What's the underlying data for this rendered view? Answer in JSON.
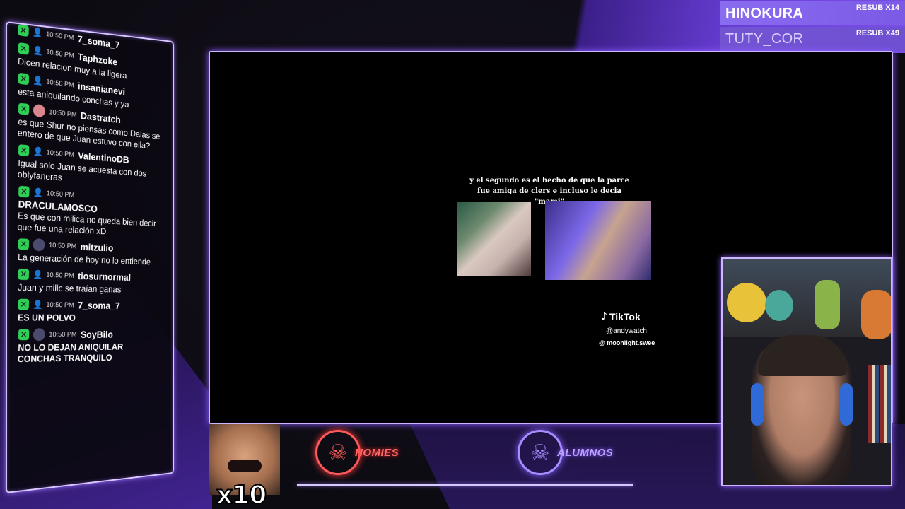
{
  "sub_alerts": [
    {
      "name": "HINOKURA",
      "label": "RESUB X14"
    },
    {
      "name": "TUTY_COR",
      "label": "RESUB X49"
    }
  ],
  "chat": {
    "messages": [
      {
        "time": "10:50 PM",
        "user": "7_soma_7",
        "text": ""
      },
      {
        "time": "10:50 PM",
        "user": "Taphzoke",
        "text": "Dicen relacion muy a la ligera"
      },
      {
        "time": "10:50 PM",
        "user": "insanianevi",
        "text": "esta aniquilando conchas y ya"
      },
      {
        "time": "10:50 PM",
        "user": "Dastratch",
        "text": "es que Shur no piensas como Dalas se entero de que Juan estuvo con ella?"
      },
      {
        "time": "10:50 PM",
        "user": "ValentinoDB",
        "text": "Igual solo Juan se acuesta con dos oblyfaneras"
      },
      {
        "time": "10:50 PM",
        "user": "DRACULAMOSCO",
        "text": "Es que con milica no queda bien decir que fue una relación xD"
      },
      {
        "time": "10:50 PM",
        "user": "mitzulio",
        "text": "La generación de hoy no lo entiende"
      },
      {
        "time": "10:50 PM",
        "user": "tiosurnormal",
        "text": "Juan y milic se traían ganas"
      },
      {
        "time": "10:50 PM",
        "user": "7_soma_7",
        "text": "ES UN POLVO"
      },
      {
        "time": "10:50 PM",
        "user": "SoyBilo",
        "text": "NO LO DEJAN ANIQUILAR CONCHAS TRANQUILO"
      }
    ]
  },
  "video": {
    "caption_line1": "y el segundo es el hecho de que la parce",
    "caption_line2": "fue amiga de clers e incluso le decia \"mami\"",
    "tiktok_word": "TikTok",
    "tiktok_handle1": "@andywatch",
    "tiktok_handle2": "@ moonlight.swee"
  },
  "bottom": {
    "emote_multiplier": "x10",
    "team1": "HOMIES",
    "team2": "ALUMNOS"
  },
  "icons": {
    "mod": "x-badge-icon",
    "user": "user-icon",
    "tiktok": "tiktok-note-icon",
    "team": "skull-mask-icon"
  },
  "colors": {
    "accent": "#8c5cff",
    "frame": "#cdb8ff",
    "mod_green": "#2fcf57",
    "homies": "#ff5a5a",
    "alumnos": "#a98cff"
  }
}
